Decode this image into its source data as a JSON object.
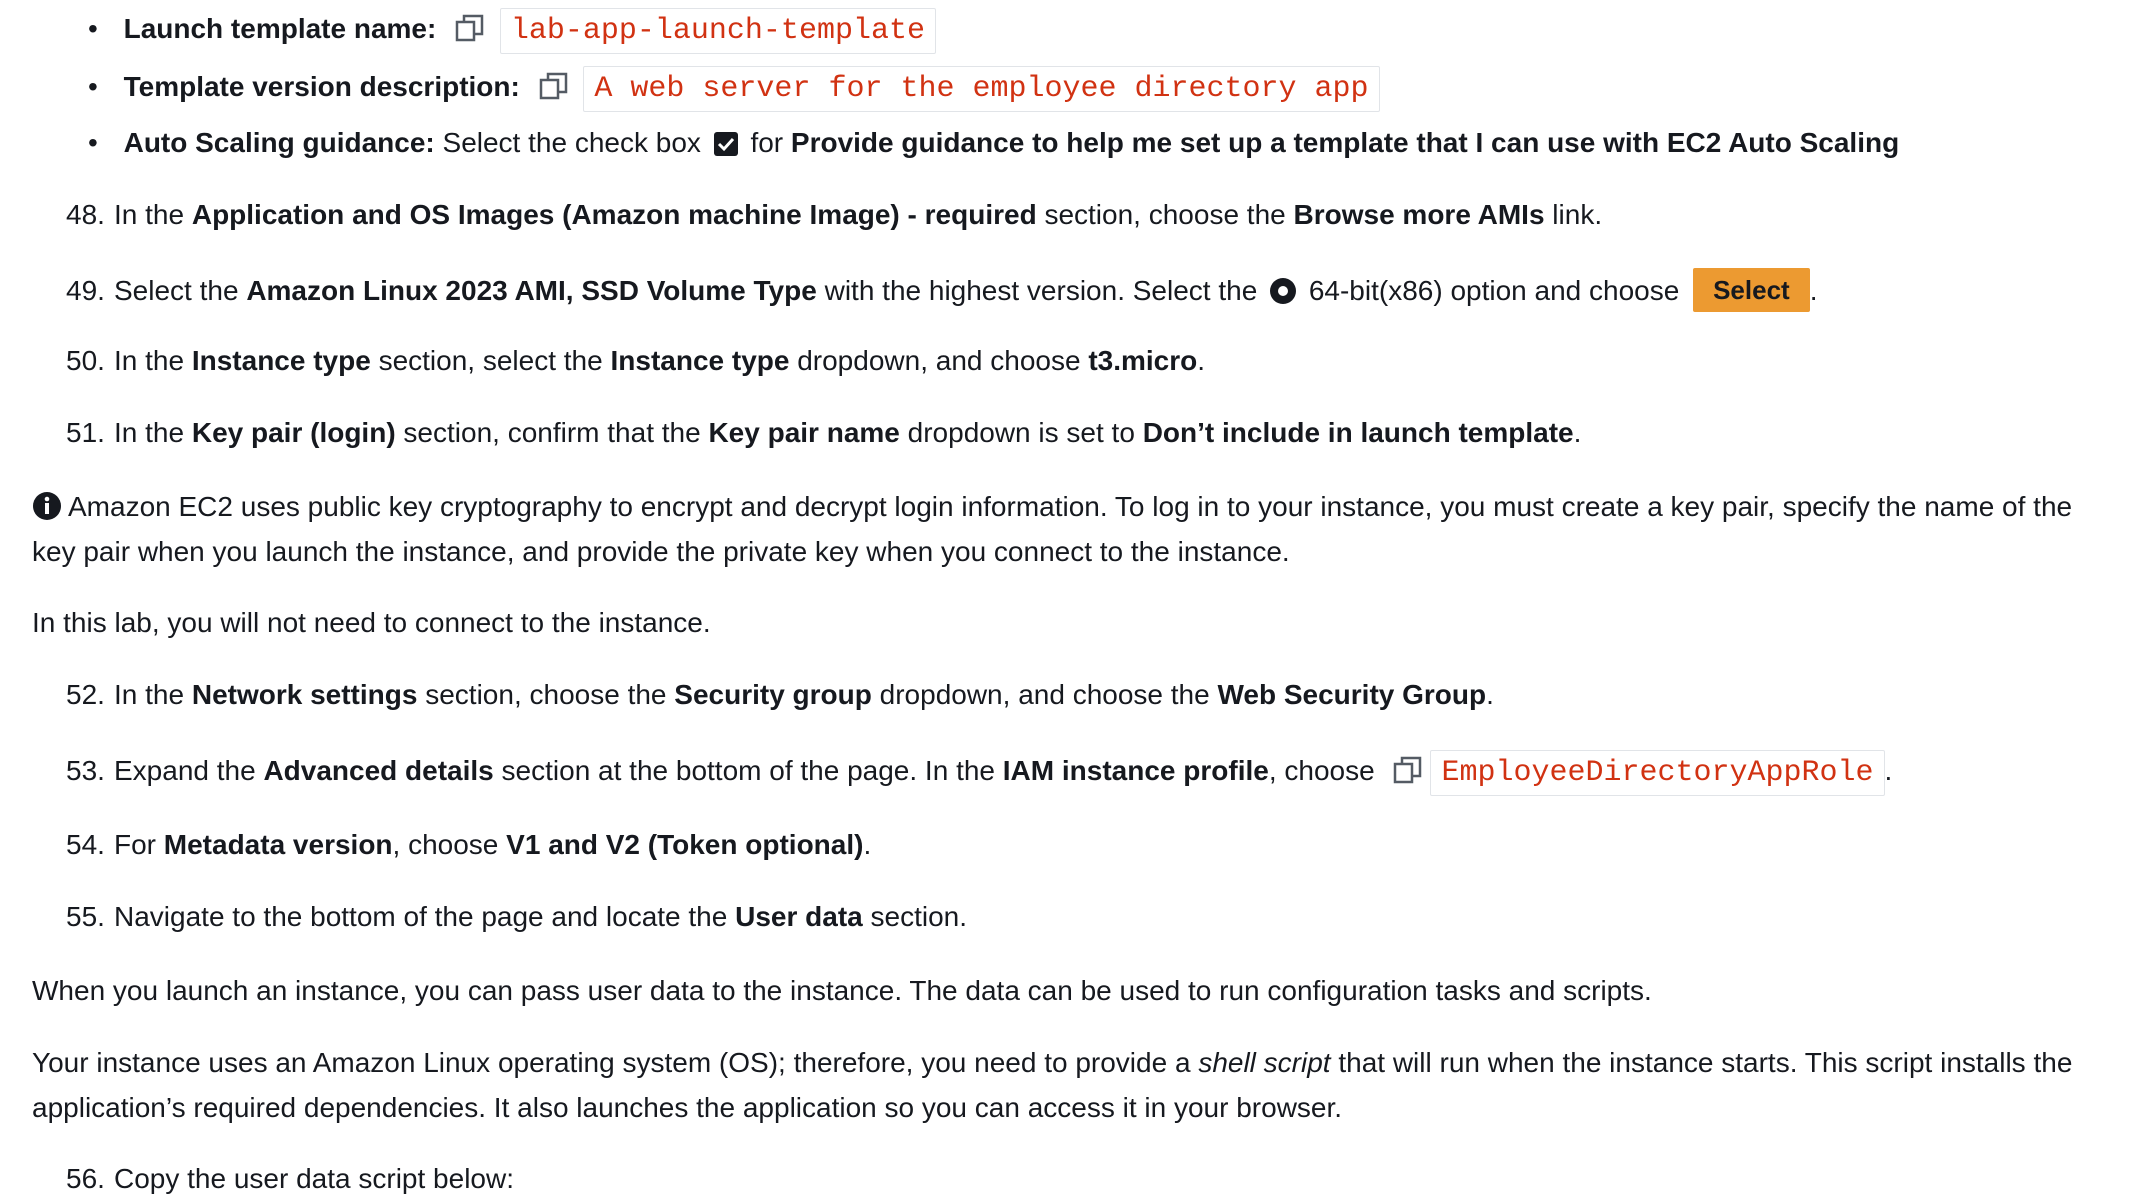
{
  "bullets": [
    {
      "label": "Launch template name:",
      "value": "lab-app-launch-template"
    },
    {
      "label": "Template version description:",
      "value": "A web server for the employee directory app"
    },
    {
      "label": "Auto Scaling guidance:",
      "text1": " Select the check box ",
      "text2": " for ",
      "bold": "Provide guidance to help me set up a template that I can use with EC2 Auto Scaling"
    }
  ],
  "steps": {
    "s48": {
      "num": "48.",
      "t1": "In the ",
      "b1": "Application and OS Images (Amazon machine Image) - required",
      "t2": " section, choose the ",
      "b2": "Browse more AMIs",
      "t3": " link."
    },
    "s49": {
      "num": "49.",
      "t1": "Select the ",
      "b1": "Amazon Linux 2023 AMI, SSD Volume Type",
      "t2": " with the highest version. Select the ",
      "t3": " 64-bit(x86) option and choose ",
      "button": "Select",
      "t4": "."
    },
    "s50": {
      "num": "50.",
      "t1": "In the ",
      "b1": "Instance type",
      "t2": " section, select the ",
      "b2": "Instance type",
      "t3": " dropdown, and choose ",
      "b3": "t3.micro",
      "t4": "."
    },
    "s51": {
      "num": "51.",
      "t1": "In the ",
      "b1": "Key pair (login)",
      "t2": " section, confirm that the ",
      "b2": "Key pair name",
      "t3": " dropdown is set to ",
      "b3": "Don’t include in launch template",
      "t4": "."
    },
    "s52": {
      "num": "52.",
      "t1": "In the ",
      "b1": "Network settings",
      "t2": " section, choose the ",
      "b2": "Security group",
      "t3": " dropdown, and choose the ",
      "b3": "Web Security Group",
      "t4": "."
    },
    "s53": {
      "num": "53.",
      "t1": "Expand the ",
      "b1": "Advanced details",
      "t2": " section at the bottom of the page. In the ",
      "b2": "IAM instance profile",
      "t3": ", choose ",
      "code": "EmployeeDirectoryAppRole",
      "t4": "."
    },
    "s54": {
      "num": "54.",
      "t1": "For ",
      "b1": "Metadata version",
      "t2": ", choose ",
      "b2": "V1 and V2 (Token optional)",
      "t3": "."
    },
    "s55": {
      "num": "55.",
      "t1": "Navigate to the bottom of the page and locate the ",
      "b1": "User data",
      "t2": " section."
    },
    "s56": {
      "num": "56.",
      "t1": "Copy the user data script below:"
    }
  },
  "paragraphs": {
    "info": "Amazon EC2 uses public key cryptography to encrypt and decrypt login information. To log in to your instance, you must create a key pair, specify the name of the key pair when you launch the instance, and provide the private key when you connect to the instance.",
    "no_connect": "In this lab, you will not need to connect to the instance.",
    "user_data": "When you launch an instance, you can pass user data to the instance. The data can be used to run configuration tasks and scripts.",
    "os_t1": "Your instance uses an Amazon Linux operating system (OS); therefore, you need to provide a ",
    "os_italic": "shell script",
    "os_t2": " that will run when the instance starts. This script installs the application’s required dependencies. It also launches the application so you can access it in your browser."
  },
  "colors": {
    "code_text": "#d13212",
    "select_button": "#ec9a31",
    "text": "#16191f"
  },
  "icons": {
    "copy": "copy-icon",
    "check": "checkbox-checked-icon",
    "radio": "radio-selected-icon",
    "info": "info-icon"
  }
}
